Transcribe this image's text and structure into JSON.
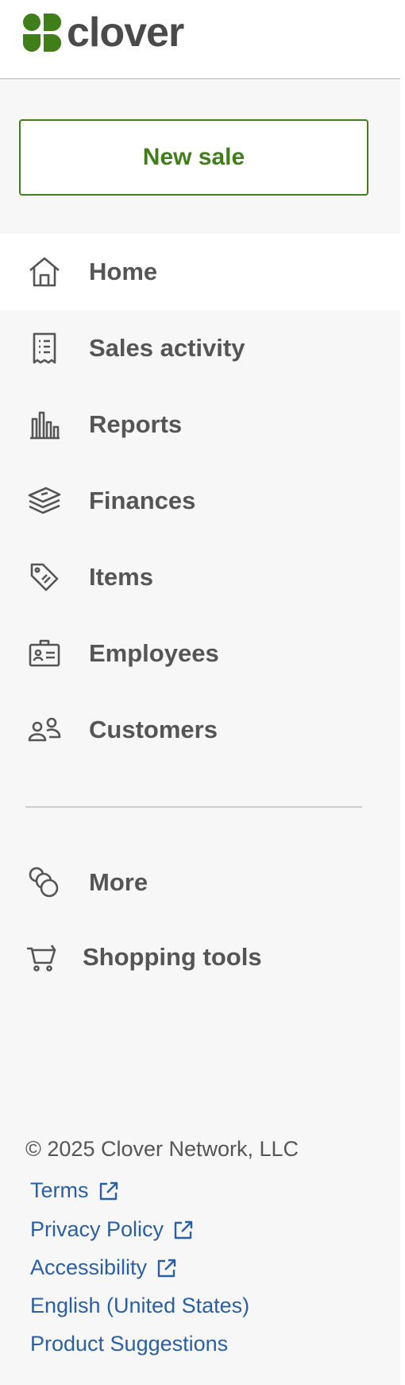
{
  "brand": {
    "name": "clover",
    "logo_icon": "clover-leaf-icon",
    "color": "#3f7e19"
  },
  "actions": {
    "new_sale_label": "New sale"
  },
  "nav": {
    "items": [
      {
        "label": "Home",
        "icon": "home-icon",
        "active": true
      },
      {
        "label": "Sales activity",
        "icon": "receipt-icon",
        "active": false
      },
      {
        "label": "Reports",
        "icon": "bar-chart-icon",
        "active": false
      },
      {
        "label": "Finances",
        "icon": "money-stack-icon",
        "active": false
      },
      {
        "label": "Items",
        "icon": "price-tag-icon",
        "active": false
      },
      {
        "label": "Employees",
        "icon": "id-badge-icon",
        "active": false
      },
      {
        "label": "Customers",
        "icon": "people-icon",
        "active": false
      }
    ]
  },
  "secondary": {
    "items": [
      {
        "label": "More",
        "icon": "circles-icon"
      },
      {
        "label": "Shopping tools",
        "icon": "shopping-cart-icon"
      }
    ]
  },
  "footer": {
    "copyright": "© 2025 Clover Network, LLC",
    "links": [
      {
        "label": "Terms",
        "external": true
      },
      {
        "label": "Privacy Policy",
        "external": true
      },
      {
        "label": "Accessibility",
        "external": true
      },
      {
        "label": "English (United States)",
        "external": false
      },
      {
        "label": "Product Suggestions",
        "external": false
      }
    ]
  },
  "colors": {
    "accent": "#3f7e19",
    "link": "#2a5fa4",
    "text": "#555555",
    "sidebar_bg": "#f7f7f7",
    "active_bg": "#ffffff"
  }
}
